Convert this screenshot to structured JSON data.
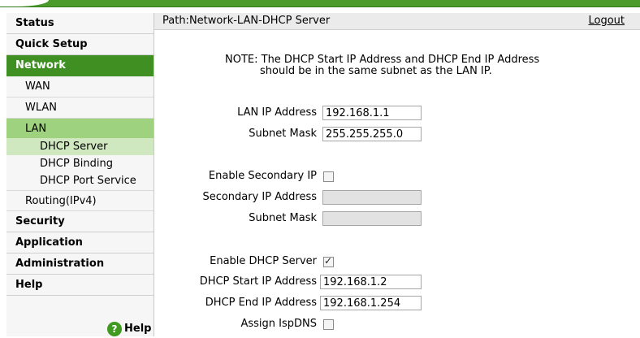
{
  "nav": {
    "status": "Status",
    "quick_setup": "Quick Setup",
    "network": "Network",
    "wan": "WAN",
    "wlan": "WLAN",
    "lan": "LAN",
    "dhcp_server": "DHCP Server",
    "dhcp_binding": "DHCP Binding",
    "dhcp_port_service": "DHCP Port Service",
    "routing": "Routing(IPv4)",
    "security": "Security",
    "application": "Application",
    "administration": "Administration",
    "help": "Help",
    "help_link": "Help",
    "help_icon_glyph": "?"
  },
  "header": {
    "path": "Path:Network-LAN-DHCP Server",
    "logout": "Logout"
  },
  "note": {
    "line1": "NOTE: The DHCP Start IP Address and DHCP End IP Address",
    "line2": "should be in the same subnet as the LAN IP."
  },
  "form": {
    "lan_ip_label": "LAN IP Address",
    "lan_ip_value": "192.168.1.1",
    "subnet_mask_label": "Subnet Mask",
    "subnet_mask_value": "255.255.255.0",
    "enable_secondary_ip_label": "Enable Secondary IP",
    "enable_secondary_ip_checked": false,
    "secondary_ip_label": "Secondary IP Address",
    "secondary_ip_value": "",
    "secondary_subnet_label": "Subnet Mask",
    "secondary_subnet_value": "",
    "enable_dhcp_label": "Enable DHCP Server",
    "enable_dhcp_checked": true,
    "dhcp_start_label": "DHCP Start IP Address",
    "dhcp_start_value": "192.168.1.2",
    "dhcp_end_label": "DHCP End IP Address",
    "dhcp_end_value": "192.168.1.254",
    "assign_ispdns_label": "Assign IspDNS",
    "assign_ispdns_checked": false
  },
  "colors": {
    "accent_green": "#3f8f23",
    "sub_active_green": "#9fd27f",
    "leaf_active_green": "#cfe8bf"
  }
}
